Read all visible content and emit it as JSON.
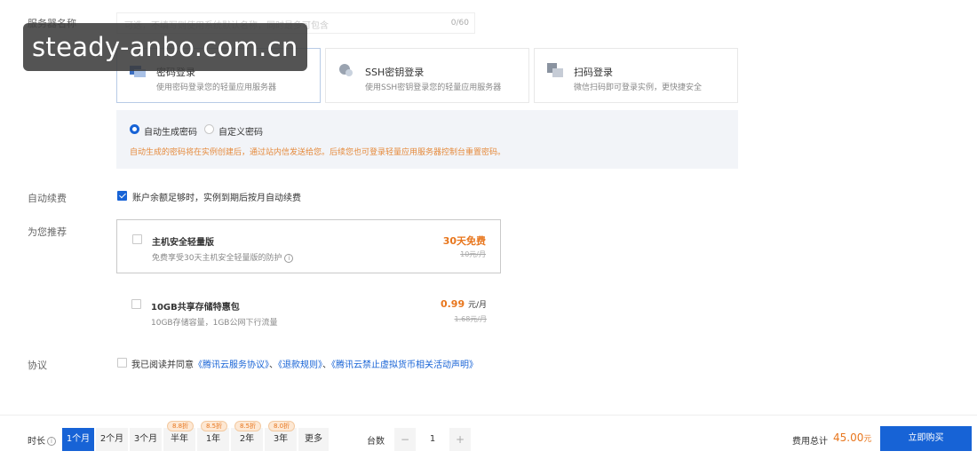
{
  "server_name": {
    "label": "服务器名称",
    "placeholder": "可选，不填写则使用系统默认名称，同时最多可包含",
    "counter": "0/60"
  },
  "watermark": "steady-anbo.com.cn",
  "login_methods": [
    {
      "title": "密码登录",
      "desc": "使用密码登录您的轻量应用服务器",
      "icon": "password-login-icon"
    },
    {
      "title": "SSH密钥登录",
      "desc": "使用SSH密钥登录您的轻量应用服务器",
      "icon": "ssh-key-icon"
    },
    {
      "title": "扫码登录",
      "desc": "微信扫码即可登录实例，更快捷安全",
      "icon": "qr-code-icon"
    }
  ],
  "password": {
    "auto_label": "自动生成密码",
    "custom_label": "自定义密码",
    "hint": "自动生成的密码将在实例创建后，通过站内信发送给您。后续您也可登录轻量应用服务器控制台重置密码。"
  },
  "auto_renew": {
    "label": "自动续费",
    "text": "账户余额足够时，实例到期后按月自动续费"
  },
  "recommend": {
    "label": "为您推荐",
    "items": [
      {
        "name": "主机安全轻量版",
        "desc": "免费享受30天主机安全轻量版的防护",
        "price": "30天免费",
        "unit": "",
        "orig": "10元/月"
      },
      {
        "name": "10GB共享存储特惠包",
        "desc": "10GB存储容量，1GB公网下行流量",
        "price": "0.99",
        "unit": "元/月",
        "orig": "1.68元/月"
      }
    ]
  },
  "agreement": {
    "label": "协议",
    "prefix": "我已阅读并同意",
    "link1": "《腾讯云服务协议》",
    "sep1": "、",
    "link2": "《退款规则》",
    "sep2": "、",
    "link3": "《腾讯云禁止虚拟货币相关活动声明》"
  },
  "bottom": {
    "duration_label": "时长",
    "durations": [
      "1个月",
      "2个月",
      "3个月",
      "半年",
      "1年",
      "2年",
      "3年",
      "更多"
    ],
    "discounts": [
      "8.8折",
      "8.5折",
      "8.5折",
      "8.0折"
    ],
    "qty_label": "台数",
    "qty_minus": "−",
    "qty_value": "1",
    "qty_plus": "+",
    "fee_label": "费用总计",
    "fee_value": "45.00",
    "fee_unit": "元",
    "buy_label": "立即购买"
  },
  "colors": {
    "accent": "#1763d6",
    "price": "#e8761d"
  }
}
